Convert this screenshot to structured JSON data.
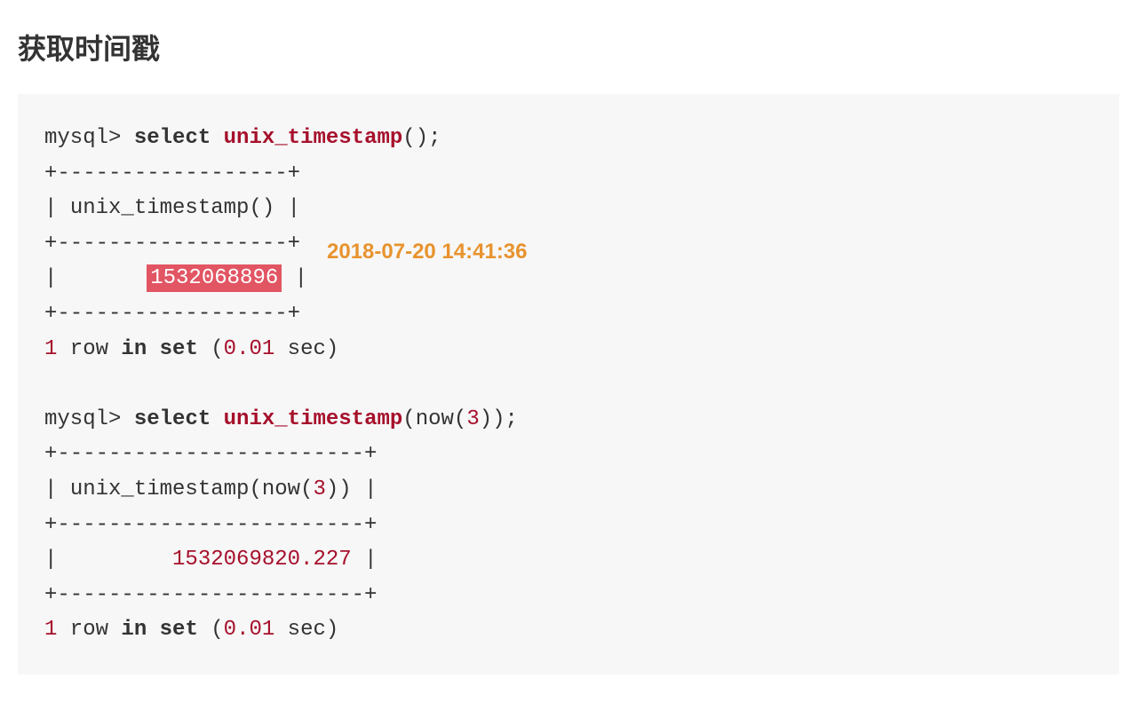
{
  "heading": "获取时间戳",
  "annotation": "2018-07-20 14:41:36",
  "code": {
    "prompt": "mysql>",
    "select_kw": "select",
    "fn_name": "unix_timestamp",
    "border1_top": "+------------------+",
    "header1_l": "| ",
    "header1_txt": "unix_timestamp()",
    "header1_r": " |",
    "row1_l": "|       ",
    "row1_val": "1532068896",
    "row1_r": " |",
    "result_1": "1",
    "result_row": " row ",
    "result_in": "in",
    "result_sp": " ",
    "result_set": "set",
    "result_paren_l": " (",
    "result_time1": "0.01",
    "result_sec": " sec)",
    "call2_args": "(now(",
    "call2_three": "3",
    "call2_close": "));",
    "border2_top": "+------------------------+",
    "header2_l": "| ",
    "header2_txt_a": "unix_timestamp(now(",
    "header2_txt_b": "3",
    "header2_txt_c": "))",
    "header2_r": " |",
    "row2_l": "|         ",
    "row2_val": "1532069820.227",
    "row2_r": " |"
  }
}
